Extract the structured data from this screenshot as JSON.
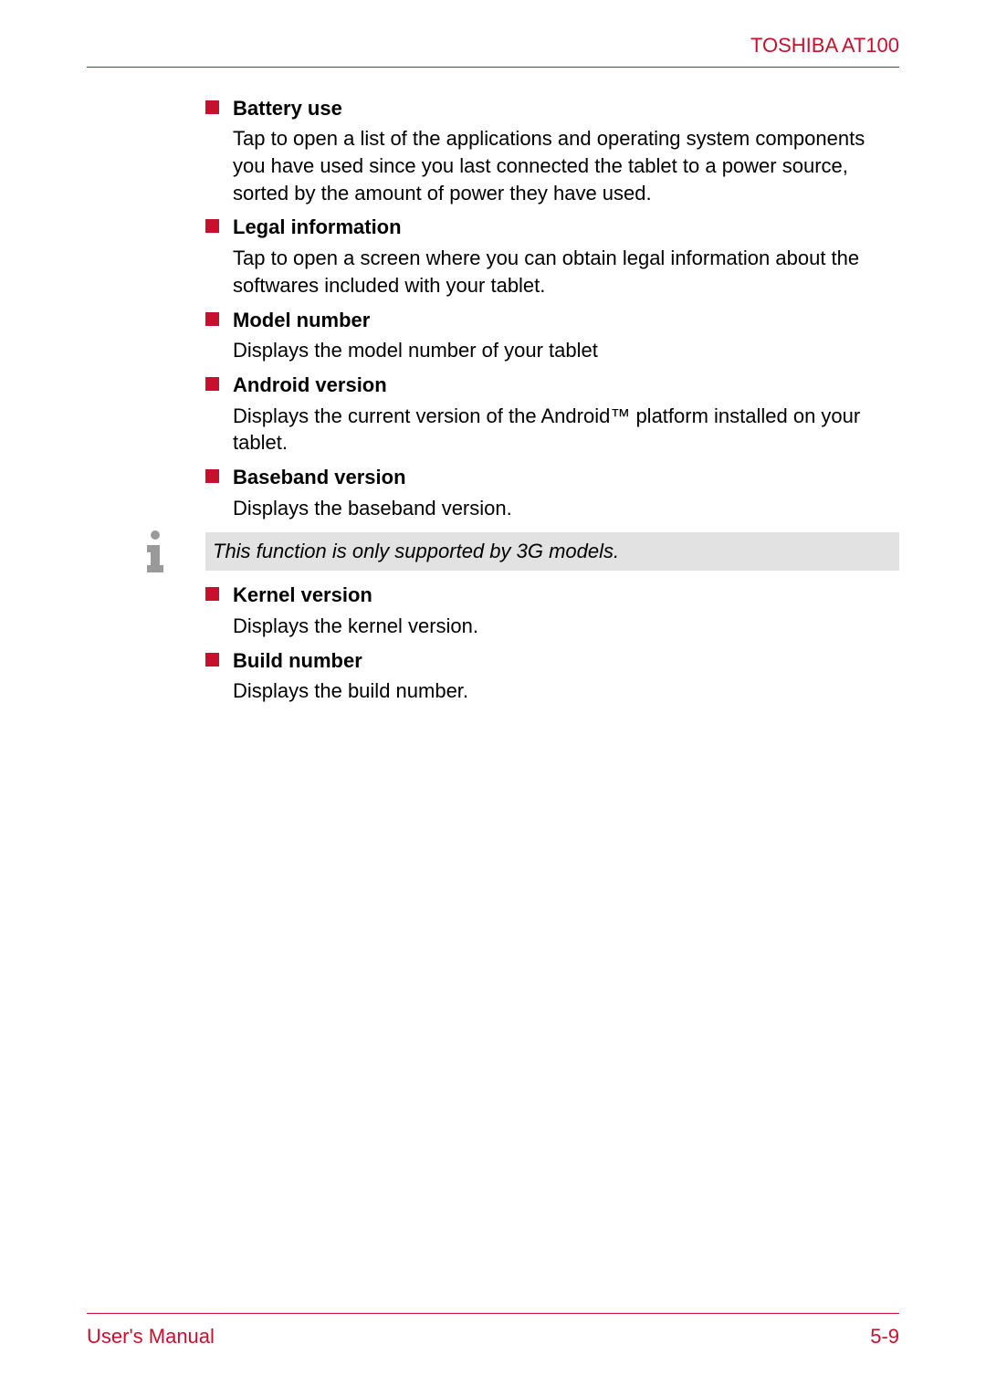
{
  "header": {
    "title": "TOSHIBA AT100"
  },
  "items": [
    {
      "heading": "Battery use",
      "desc": "Tap to open a list of the applications and operating system components you have used since you last connected the tablet to a power source, sorted by the amount of power they have used."
    },
    {
      "heading": "Legal information",
      "desc": "Tap to open a screen where you can obtain legal information about the softwares included with your tablet."
    },
    {
      "heading": "Model number",
      "desc": "Displays the model number of your tablet"
    },
    {
      "heading": "Android version",
      "desc": "Displays the current version of the Android™ platform installed on your tablet."
    },
    {
      "heading": "Baseband version",
      "desc": "Displays the baseband version."
    }
  ],
  "note": {
    "text": "This function is only supported by 3G models."
  },
  "items_after": [
    {
      "heading": "Kernel version",
      "desc": "Displays the kernel version."
    },
    {
      "heading": "Build number",
      "desc": "Displays the build number."
    }
  ],
  "footer": {
    "left": "User's Manual",
    "right": "5-9"
  }
}
